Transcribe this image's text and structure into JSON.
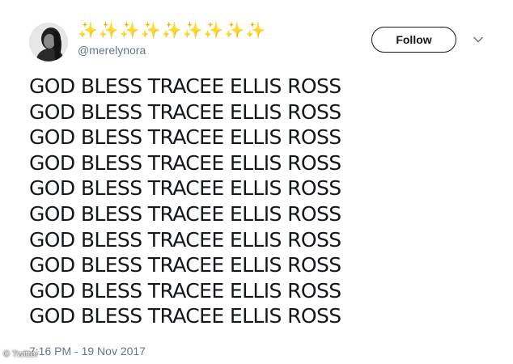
{
  "tweet": {
    "display_name": "✨✨✨✨✨✨✨✨✨",
    "handle": "@merelynora",
    "follow_label": "Follow",
    "text_lines": [
      "GOD BLESS TRACEE ELLIS ROSS",
      "GOD BLESS TRACEE ELLIS ROSS",
      "GOD BLESS TRACEE ELLIS ROSS",
      "GOD BLESS TRACEE ELLIS ROSS",
      "GOD BLESS TRACEE ELLIS ROSS",
      "GOD BLESS TRACEE ELLIS ROSS",
      "GOD BLESS TRACEE ELLIS ROSS",
      "GOD BLESS TRACEE ELLIS ROSS",
      "GOD BLESS TRACEE ELLIS ROSS",
      "GOD BLESS TRACEE ELLIS ROSS"
    ],
    "timestamp": "7:16 PM - 19 Nov 2017"
  },
  "watermark": "© Twitter",
  "icons": {
    "caret": "chevron-down-icon",
    "avatar": "avatar-photo"
  },
  "colors": {
    "text": "#14171a",
    "secondary": "#657786",
    "sparkles": "#a98ce0",
    "border": "#14171a"
  }
}
